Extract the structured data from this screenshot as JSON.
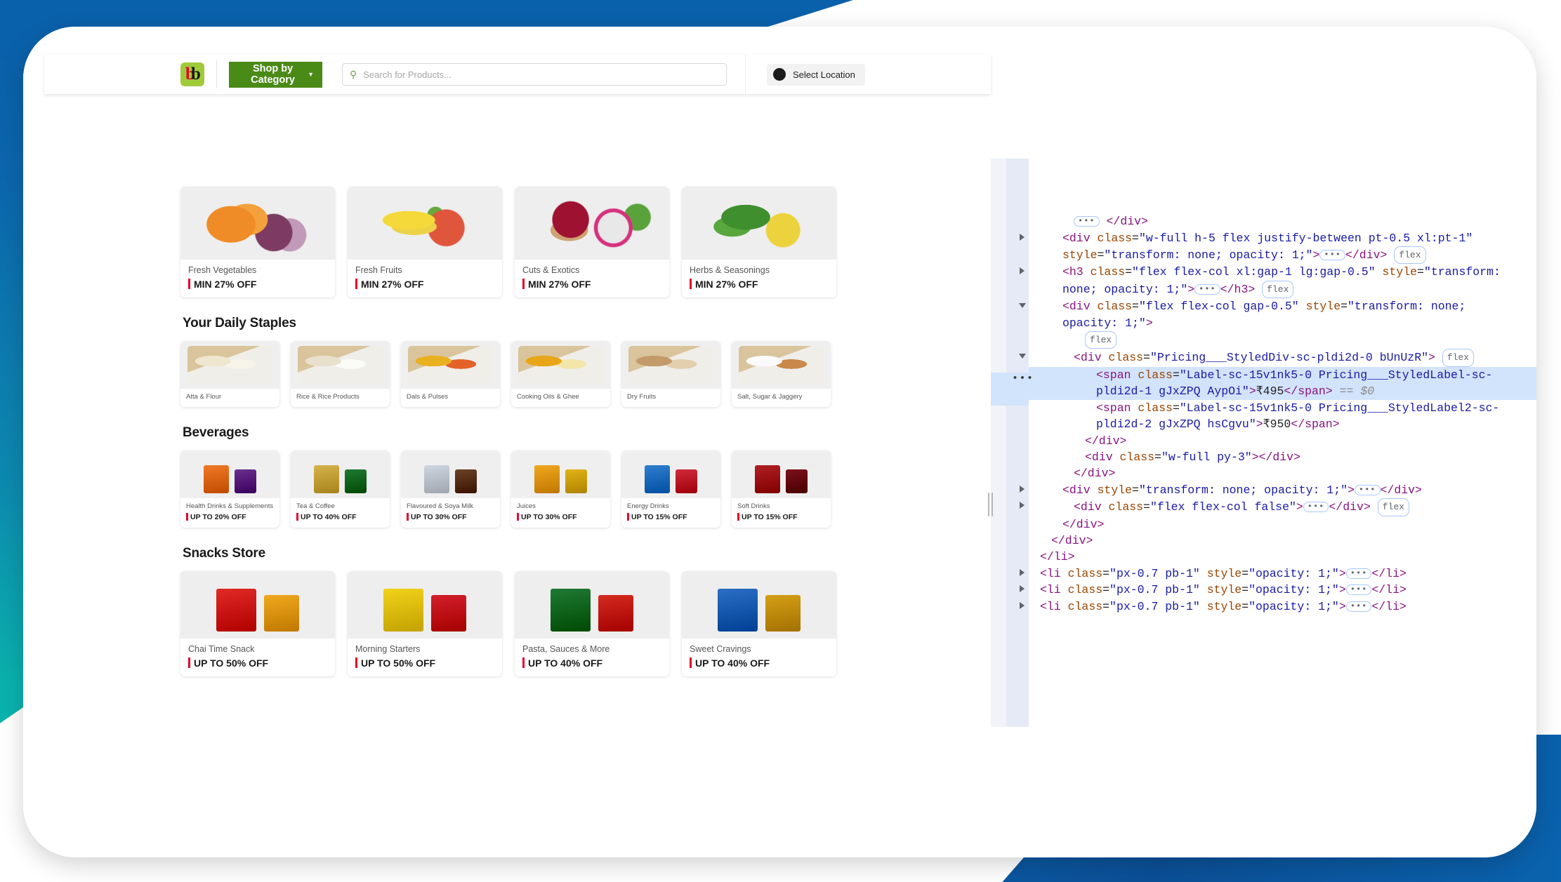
{
  "header": {
    "logo_alt": "bigbasket-logo",
    "shop_by_category": "Shop by Category",
    "caret": "▼",
    "search_icon": "search-icon",
    "search_placeholder": "Search for Products...",
    "search_value": "",
    "location_label": "Select Location"
  },
  "sections": [
    {
      "id": "top-categories",
      "title": "",
      "layout": "four",
      "cards": [
        {
          "name": "Fresh Vegetables",
          "offer": "MIN 27% OFF",
          "art": "veg"
        },
        {
          "name": "Fresh Fruits",
          "offer": "MIN 27% OFF",
          "art": "fruit"
        },
        {
          "name": "Cuts & Exotics",
          "offer": "MIN 27% OFF",
          "art": "exotic"
        },
        {
          "name": "Herbs & Seasonings",
          "offer": "MIN 27% OFF",
          "art": "herb"
        }
      ]
    },
    {
      "id": "daily-staples",
      "title": "Your Daily Staples",
      "layout": "six",
      "cards": [
        {
          "name": "Atta & Flour",
          "offer": "",
          "art": "staple"
        },
        {
          "name": "Rice & Rice Products",
          "offer": "",
          "art": "staple"
        },
        {
          "name": "Dals & Pulses",
          "offer": "",
          "art": "staple"
        },
        {
          "name": "Cooking Oils & Ghee",
          "offer": "",
          "art": "staple"
        },
        {
          "name": "Dry Fruits",
          "offer": "",
          "art": "staple"
        },
        {
          "name": "Salt, Sugar & Jaggery",
          "offer": "",
          "art": "staple"
        }
      ]
    },
    {
      "id": "beverages",
      "title": "Beverages",
      "layout": "six",
      "cards": [
        {
          "name": "Health Drinks & Supplements",
          "offer": "UP TO 20% OFF",
          "art": "pack"
        },
        {
          "name": "Tea & Coffee",
          "offer": "UP TO 40% OFF",
          "art": "pack"
        },
        {
          "name": "Flavoured & Soya Milk",
          "offer": "UP TO 30% OFF",
          "art": "pack"
        },
        {
          "name": "Juices",
          "offer": "UP TO 30% OFF",
          "art": "pack"
        },
        {
          "name": "Energy Drinks",
          "offer": "UP TO 15% OFF",
          "art": "pack"
        },
        {
          "name": "Soft Drinks",
          "offer": "UP TO 15% OFF",
          "art": "pack"
        }
      ]
    },
    {
      "id": "snacks-store",
      "title": "Snacks Store",
      "layout": "four",
      "cards": [
        {
          "name": "Chai Time Snack",
          "offer": "UP TO 50% OFF",
          "art": "pack"
        },
        {
          "name": "Morning Starters",
          "offer": "UP TO 50% OFF",
          "art": "pack"
        },
        {
          "name": "Pasta, Sauces & More",
          "offer": "UP TO 40% OFF",
          "art": "pack"
        },
        {
          "name": "Sweet Cravings",
          "offer": "UP TO 40% OFF",
          "art": "pack"
        }
      ]
    }
  ],
  "devtools": {
    "selected_value": "₹495",
    "second_value": "₹950",
    "flex_badge": "flex",
    "selection_marker": "== $0",
    "lines": [
      {
        "indent": 3,
        "twisty": "none",
        "html": "<span class=\"ellipsis\">•••</span><span class=\"tag\">&lt;/div&gt;</span>"
      },
      {
        "indent": 2,
        "twisty": "closed",
        "html": "<span class=\"tag\">&lt;div </span><span class=\"attr\">class</span>=<span class=\"val\">\"w-full h-5 flex justify-between pt-0.5 xl:pt-1\"</span> <span class=\"attr\">style</span>=<span class=\"val\">\"transform: none; opacity: 1;\"</span><span class=\"tag\">&gt;</span><span class=\"ellipsis\">•••</span><span class=\"tag\">&lt;/div&gt;</span> <span class=\"flexbadge\">flex</span>"
      },
      {
        "indent": 2,
        "twisty": "closed",
        "html": "<span class=\"tag\">&lt;h3 </span><span class=\"attr\">class</span>=<span class=\"val\">\"flex flex-col xl:gap-1 lg:gap-0.5\"</span> <span class=\"attr\">style</span>=<span class=\"val\">\"transform: none; opacity: 1;\"</span><span class=\"tag\">&gt;</span><span class=\"ellipsis\">•••</span><span class=\"tag\">&lt;/h3&gt;</span> <span class=\"flexbadge\">flex</span>"
      },
      {
        "indent": 2,
        "twisty": "open",
        "html": "<span class=\"tag\">&lt;div </span><span class=\"attr\">class</span>=<span class=\"val\">\"flex flex-col gap-0.5\"</span> <span class=\"attr\">style</span>=<span class=\"val\">\"transform: none; opacity: 1;\"</span><span class=\"tag\">&gt;</span>"
      },
      {
        "indent": 4,
        "twisty": "none",
        "html": "<span class=\"flexbadge\">flex</span>"
      },
      {
        "indent": 3,
        "twisty": "open",
        "html": "<span class=\"tag\">&lt;div </span><span class=\"attr\">class</span>=<span class=\"val\">\"Pricing___StyledDiv-sc-pldi2d-0 bUnUzR\"</span><span class=\"tag\">&gt;</span> <span class=\"flexbadge\">flex</span>"
      }
    ]
  }
}
